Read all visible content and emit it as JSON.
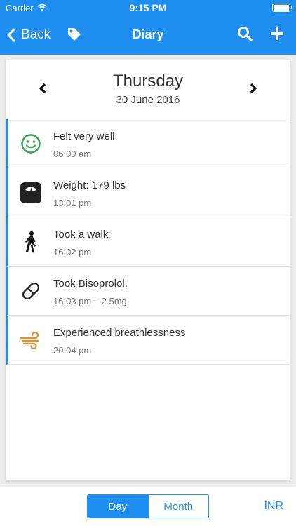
{
  "status_bar": {
    "carrier": "Carrier",
    "time": "9:15 PM"
  },
  "nav": {
    "back_label": "Back",
    "title": "Diary",
    "icons": {
      "back": "chevron-left-icon",
      "tag": "tag-icon",
      "search": "search-icon",
      "add": "plus-icon"
    }
  },
  "date_header": {
    "day": "Thursday",
    "date": "30 June 2016"
  },
  "entries": [
    {
      "icon": "smiley-icon",
      "title": "Felt very well.",
      "time": "06:00 am"
    },
    {
      "icon": "scale-icon",
      "title": "Weight: 179 lbs",
      "time": "13:01 pm"
    },
    {
      "icon": "walking-icon",
      "title": "Took a walk",
      "time": "16:02 pm"
    },
    {
      "icon": "pill-icon",
      "title": "Took Bisoprolol.",
      "time": "16:03 pm – 2.5mg"
    },
    {
      "icon": "wind-icon",
      "title": "Experienced breathlessness",
      "time": "20:04 pm"
    }
  ],
  "footer": {
    "day_tab": "Day",
    "month_tab": "Month",
    "selected_tab": "Day",
    "inr_label": "INR"
  },
  "colors": {
    "accent": "#1e8ff0",
    "smiley": "#3aa54a",
    "wind": "#f08a24",
    "scale": "#222222"
  }
}
